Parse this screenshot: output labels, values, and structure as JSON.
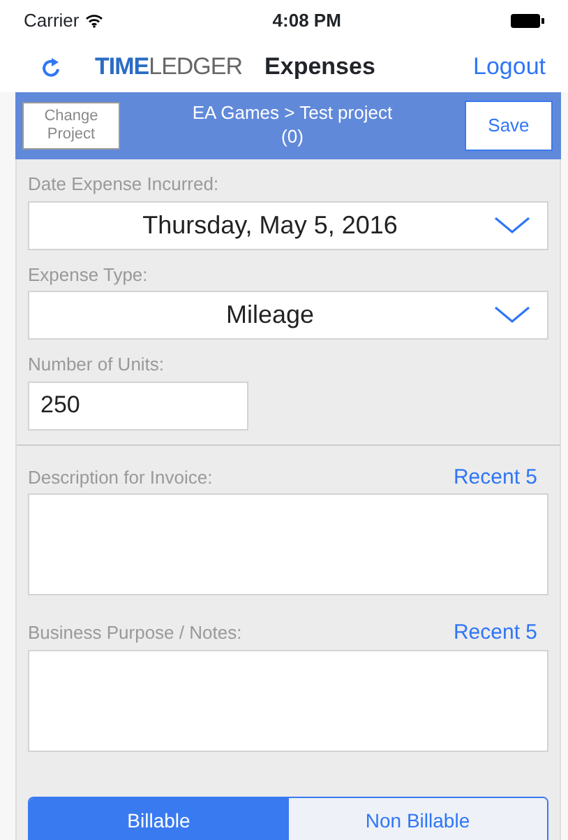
{
  "status_bar": {
    "carrier": "Carrier",
    "time": "4:08 PM"
  },
  "nav_bar": {
    "logo_primary": "TIME",
    "logo_secondary": "LEDGER",
    "title": "Expenses",
    "logout": "Logout"
  },
  "project_bar": {
    "change_button": "Change Project",
    "project": "EA Games > Test project",
    "count": "(0)",
    "save_button": "Save"
  },
  "fields": [
    {
      "kind": "select",
      "label": "Date Expense Incurred:",
      "value": "Thursday, May 5, 2016"
    },
    {
      "kind": "select",
      "label": "Expense Type:",
      "value": "Mileage"
    },
    {
      "kind": "input",
      "label": "Number of Units:",
      "value": "250"
    },
    {
      "kind": "textarea",
      "label": "Description for Invoice:",
      "link": "Recent 5"
    },
    {
      "kind": "textarea",
      "label": "Business Purpose / Notes:",
      "link": "Recent 5"
    }
  ],
  "billing": [
    {
      "label": "Billable",
      "selected": true
    },
    {
      "label": "Non Billable",
      "selected": false
    }
  ]
}
